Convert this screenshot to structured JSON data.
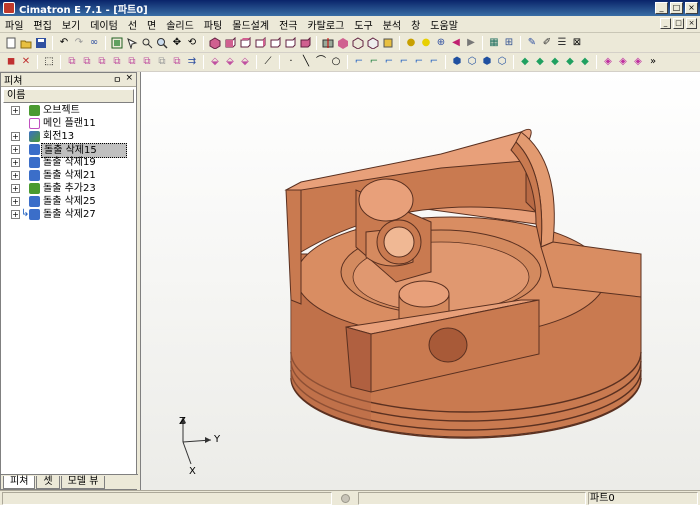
{
  "window": {
    "title": "Cimatron E 7.1 - [파트0]",
    "buttons": {
      "minimize": "_",
      "maximize": "□",
      "close": "×"
    }
  },
  "menu": {
    "items": [
      "파일",
      "편집",
      "보기",
      "데이텀",
      "선",
      "면",
      "솔리드",
      "파팅",
      "몰드설계",
      "전극",
      "카탈로그",
      "도구",
      "분석",
      "창",
      "도움말"
    ]
  },
  "toolbar1": {
    "icons": [
      "new-file",
      "open-folder",
      "save",
      "undo",
      "redo",
      "link",
      "zoom-fit",
      "select",
      "zoom",
      "zoom-in",
      "pan",
      "rotate",
      "view-iso",
      "view-front",
      "view-top",
      "view-right",
      "view-left",
      "view-back",
      "view-bottom",
      "section",
      "render-shaded",
      "render-wire",
      "render-hidden",
      "display-mode",
      "light-bulb",
      "light-on",
      "measure",
      "arrow-prev",
      "arrow-next",
      "layers",
      "filter",
      "pen",
      "color-edit",
      "grid",
      "close-doc"
    ]
  },
  "toolbar2": {
    "icons": [
      "selection-1",
      "selection-2",
      "select-arrow",
      "link-1",
      "link-2",
      "link-3",
      "link-4",
      "link-5",
      "link-6",
      "link-7",
      "link-8",
      "link-9",
      "sketch-1",
      "sketch-2",
      "sketch-3",
      "polyline",
      "dot",
      "line",
      "arc",
      "circle",
      "curve",
      "curve-2",
      "curve-3",
      "curve-4",
      "curve-5",
      "curve-6",
      "solid-1",
      "solid-2",
      "solid-3",
      "solid-4",
      "surface-1",
      "surface-2",
      "surface-3",
      "surface-4",
      "surface-5",
      "pink-1",
      "pink-2",
      "pink-3",
      "more"
    ]
  },
  "feature_panel": {
    "title": "피쳐",
    "pin": "ㅁ",
    "close": "×",
    "column_header": "이름",
    "tree": [
      {
        "label": "오브젝트",
        "expander": "+",
        "icon_color": "#4a9a30"
      },
      {
        "label": "메인 플랜11",
        "expander": "",
        "icon_color": "#c050c0"
      },
      {
        "label": "회전13",
        "expander": "+",
        "icon_color": "#3b6ec9"
      },
      {
        "label": "돌출 삭제15",
        "expander": "+",
        "icon_color": "#3b6ec9",
        "selected": true
      },
      {
        "label": "돌출 삭제19",
        "expander": "+",
        "icon_color": "#3b6ec9"
      },
      {
        "label": "돌출 삭제21",
        "expander": "+",
        "icon_color": "#3b6ec9"
      },
      {
        "label": "돌출 추가23",
        "expander": "+",
        "icon_color": "#4a9a30"
      },
      {
        "label": "돌출 삭제25",
        "expander": "+",
        "icon_color": "#3b6ec9"
      },
      {
        "label": "돌출 삭제27",
        "expander": "+",
        "icon_color": "#3b6ec9"
      }
    ],
    "tabs": [
      "피쳐",
      "셋",
      "모델 뷰"
    ]
  },
  "viewport": {
    "axes": {
      "z": "Z",
      "y": "Y",
      "x": "X"
    },
    "model_color": "#d9875c"
  },
  "statusbar": {
    "part_name": "파트0"
  }
}
